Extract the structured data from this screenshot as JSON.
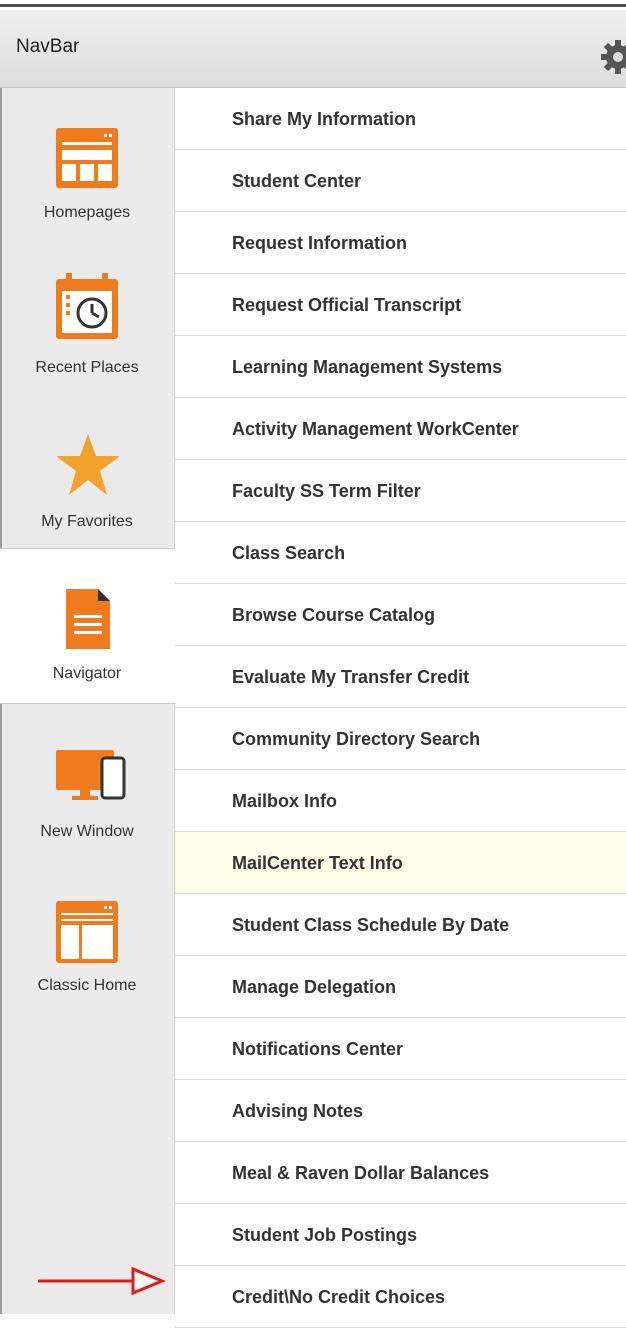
{
  "navbar": {
    "title": "NavBar",
    "settings_icon": "gear-icon"
  },
  "sidebar": {
    "tiles": [
      {
        "label": "Homepages",
        "icon": "homepages-icon"
      },
      {
        "label": "Recent Places",
        "icon": "calendar-clock-icon"
      },
      {
        "label": "My Favorites",
        "icon": "star-icon"
      },
      {
        "label": "Navigator",
        "icon": "document-icon",
        "active": true
      },
      {
        "label": "New Window",
        "icon": "monitor-phone-icon"
      },
      {
        "label": "Classic Home",
        "icon": "classic-home-icon"
      }
    ]
  },
  "menu": {
    "items": [
      "Share My Information",
      "Student Center",
      "Request Information",
      "Request Official Transcript",
      "Learning Management Systems",
      "Activity Management WorkCenter",
      "Faculty SS Term Filter",
      "Class Search",
      "Browse Course Catalog",
      "Evaluate My Transfer Credit",
      "Community Directory Search",
      "Mailbox Info",
      "MailCenter Text Info",
      "Student Class Schedule By Date",
      "Manage Delegation",
      "Notifications Center",
      "Advising Notes",
      "Meal & Raven Dollar Balances",
      "Student Job Postings",
      "Credit\\No Credit Choices"
    ],
    "highlighted_item": "MailCenter Text Info"
  },
  "colors": {
    "accent": "#f07a1e",
    "star": "#f2a12b",
    "arrow": "#e31b1b",
    "highlight": "#fdfde7"
  }
}
